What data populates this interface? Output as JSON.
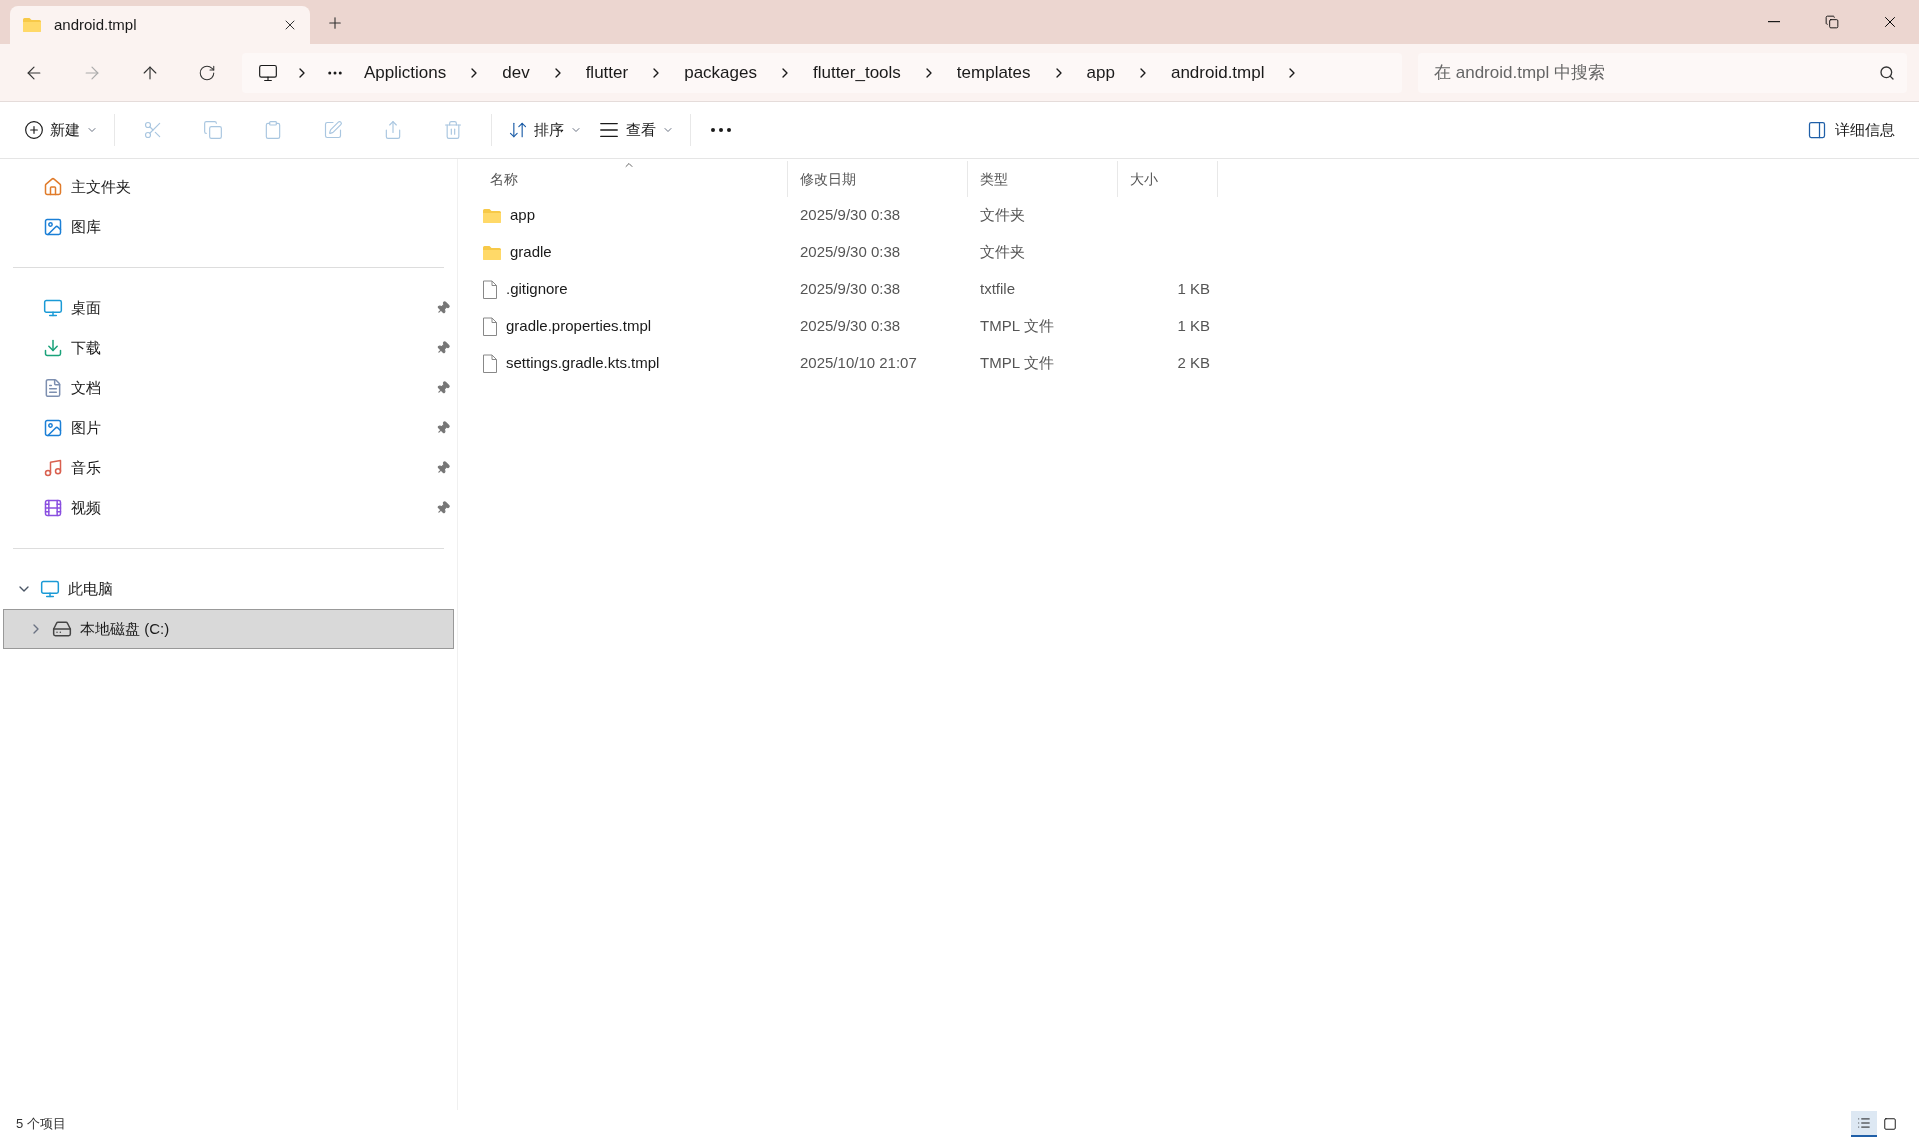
{
  "tab": {
    "title": "android.tmpl"
  },
  "breadcrumb": [
    "Applictions",
    "dev",
    "flutter",
    "packages",
    "flutter_tools",
    "templates",
    "app",
    "android.tmpl"
  ],
  "search": {
    "placeholder": "在 android.tmpl 中搜索"
  },
  "toolbar": [
    {
      "kind": "new",
      "label": "新建",
      "disabled": false
    },
    {
      "kind": "cut",
      "disabled": true
    },
    {
      "kind": "copy",
      "disabled": true
    },
    {
      "kind": "paste",
      "disabled": true
    },
    {
      "kind": "rename",
      "disabled": true
    },
    {
      "kind": "share",
      "disabled": true
    },
    {
      "kind": "delete",
      "disabled": true
    },
    {
      "kind": "sort",
      "label": "排序",
      "disabled": false
    },
    {
      "kind": "view",
      "label": "查看",
      "disabled": false
    },
    {
      "kind": "more",
      "disabled": false
    }
  ],
  "details_button": {
    "label": "详细信息"
  },
  "sidebar": {
    "top": [
      {
        "kind": "home",
        "label": "主文件夹"
      },
      {
        "kind": "gallery",
        "label": "图库"
      }
    ],
    "pinned": [
      {
        "kind": "desktop",
        "label": "桌面",
        "pinned": true
      },
      {
        "kind": "download",
        "label": "下载",
        "pinned": true
      },
      {
        "kind": "documents",
        "label": "文档",
        "pinned": true
      },
      {
        "kind": "pictures",
        "label": "图片",
        "pinned": true
      },
      {
        "kind": "music",
        "label": "音乐",
        "pinned": true
      },
      {
        "kind": "videos",
        "label": "视频",
        "pinned": true
      }
    ],
    "tree": [
      {
        "kind": "pc",
        "label": "此电脑",
        "expanded": true,
        "selected": false,
        "children": [
          {
            "kind": "drive",
            "label": "本地磁盘 (C:)",
            "expanded": false,
            "selected": true
          }
        ]
      }
    ]
  },
  "columns": [
    {
      "label": "名称",
      "sorted": true
    },
    {
      "label": "修改日期",
      "sorted": false
    },
    {
      "label": "类型",
      "sorted": false
    },
    {
      "label": "大小",
      "sorted": false
    }
  ],
  "files": [
    {
      "kind": "folder",
      "name": "app",
      "date": "2025/9/30 0:38",
      "type": "文件夹"
    },
    {
      "kind": "folder",
      "name": "gradle",
      "date": "2025/9/30 0:38",
      "type": "文件夹"
    },
    {
      "kind": "file",
      "name": ".gitignore",
      "date": "2025/9/30 0:38",
      "type": "txtfile",
      "size": "1 KB"
    },
    {
      "kind": "file",
      "name": "gradle.properties.tmpl",
      "date": "2025/9/30 0:38",
      "type": "TMPL 文件",
      "size": "1 KB"
    },
    {
      "kind": "file",
      "name": "settings.gradle.kts.tmpl",
      "date": "2025/10/10 21:07",
      "type": "TMPL 文件",
      "size": "2 KB"
    }
  ],
  "status_bar": {
    "count": "5 个项目",
    "views": [
      {
        "kind": "details",
        "selected": true
      },
      {
        "kind": "tiles",
        "selected": false
      }
    ]
  }
}
